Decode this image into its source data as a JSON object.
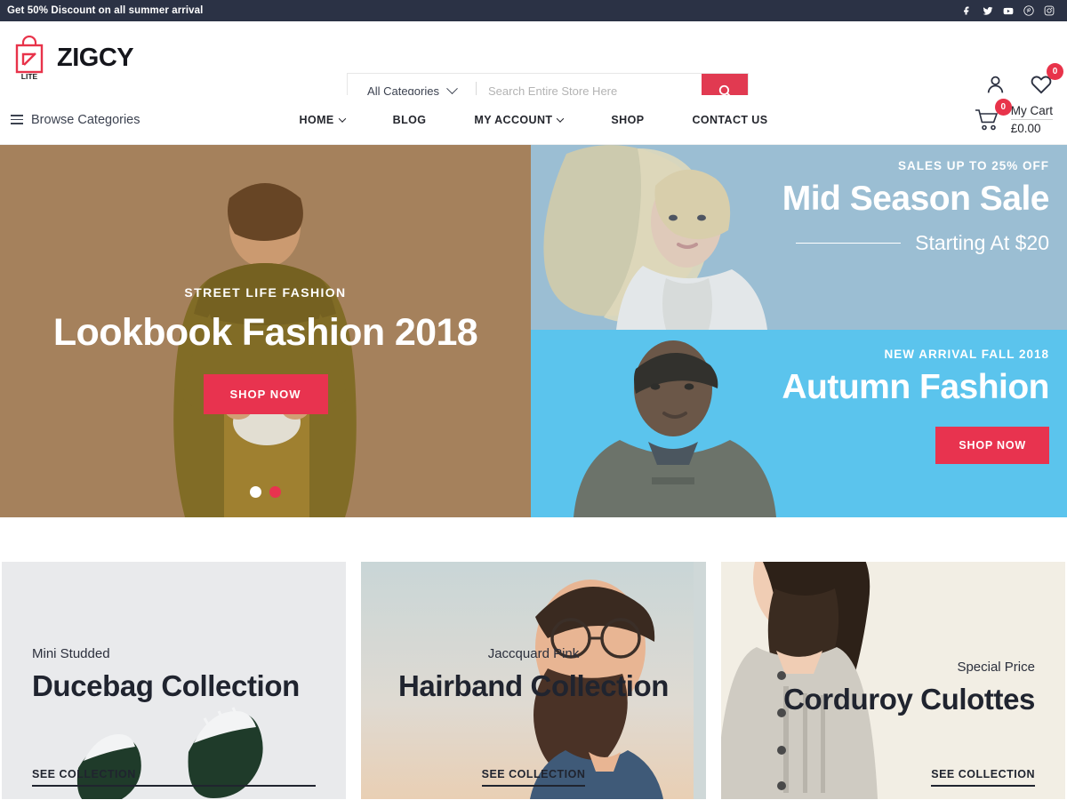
{
  "topbar": {
    "promo_text": "Get 50% Discount on all summer arrival",
    "social": [
      {
        "name": "facebook-icon",
        "glyph": "f"
      },
      {
        "name": "twitter-icon",
        "glyph": "t"
      },
      {
        "name": "youtube-icon",
        "glyph": "y"
      },
      {
        "name": "pinterest-icon",
        "glyph": "p"
      },
      {
        "name": "instagram-icon",
        "glyph": "i"
      }
    ],
    "bg_color": "#2b3245"
  },
  "header": {
    "logo_text": "ZIGCY",
    "logo_sub": "LITE",
    "logo_color": "#e8334a",
    "search": {
      "category_label": "All Categories",
      "placeholder": "Search Entire Store Here",
      "value": "",
      "button_color": "#e13a51"
    },
    "account_icon": "user-icon",
    "wishlist": {
      "icon": "heart-icon",
      "count": "0"
    }
  },
  "nav": {
    "browse_label": "Browse Categories",
    "items": [
      {
        "label": "HOME",
        "has_dropdown": true
      },
      {
        "label": "BLOG",
        "has_dropdown": false
      },
      {
        "label": "MY ACCOUNT",
        "has_dropdown": true
      },
      {
        "label": "SHOP",
        "has_dropdown": false
      },
      {
        "label": "CONTACT US",
        "has_dropdown": false
      }
    ],
    "cart": {
      "count": "0",
      "label": "My Cart",
      "price": "£0.00"
    }
  },
  "hero": {
    "slide": {
      "kicker": "STREET LIFE FASHION",
      "title": "Lookbook Fashion 2018",
      "button": "SHOP NOW",
      "bg_color": "#b08a62"
    },
    "dots": [
      {
        "state": "inactive"
      },
      {
        "state": "active"
      }
    ],
    "banners": [
      {
        "kicker": "SALES UP TO 25% OFF",
        "title": "Mid Season Sale",
        "subtitle": "Starting At $20",
        "bg_color": "#9cbfd4"
      },
      {
        "kicker": "NEW ARRIVAL FALL 2018",
        "title": "Autumn Fashion",
        "button": "SHOP NOW",
        "bg_color": "#5cc4ee"
      }
    ]
  },
  "collections": [
    {
      "kicker": "Mini Studded",
      "title": "Ducebag Collection",
      "link": "SEE COLLECTION",
      "bg_color": "#e9eaec"
    },
    {
      "kicker": "Jaccquard Pink",
      "title": "Hairband Collection",
      "link": "SEE COLLECTION",
      "bg_color": "#cfd8d8"
    },
    {
      "kicker": "Special Price",
      "title": "Corduroy Culottes",
      "link": "SEE COLLECTION",
      "bg_color": "#f2eee4"
    }
  ]
}
